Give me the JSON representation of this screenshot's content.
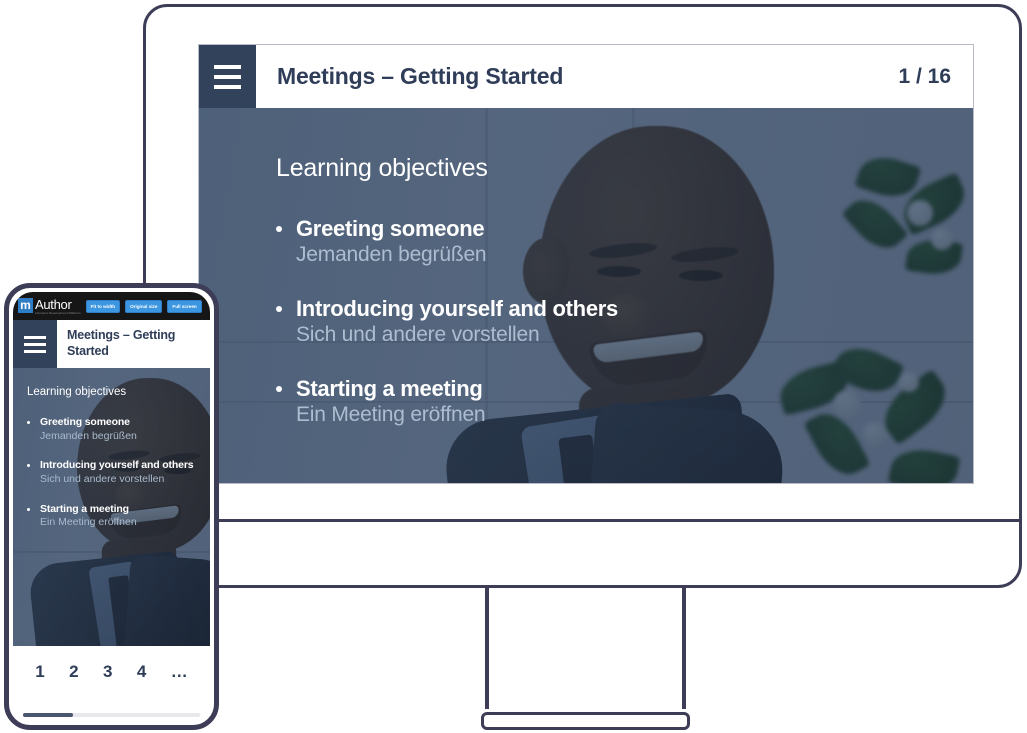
{
  "desktop": {
    "menu_icon": "hamburger-menu-icon",
    "title": "Meetings – Getting Started",
    "page_counter": "1 / 16",
    "slide": {
      "heading": "Learning objectives",
      "bullets": [
        {
          "en": "Greeting someone",
          "de": "Jemanden begrüßen"
        },
        {
          "en": "Introducing yourself and others",
          "de": "Sich und andere vorstellen"
        },
        {
          "en": "Starting a meeting",
          "de": "Ein Meeting eröffnen"
        }
      ]
    }
  },
  "phone": {
    "browser_bar": {
      "logo_mark": "m",
      "logo_word": "Author",
      "logo_tagline": "eContent Development Platform",
      "buttons": [
        "Fit to width",
        "Original size",
        "Full screen"
      ]
    },
    "menu_icon": "hamburger-menu-icon",
    "title": "Meetings – Getting Started",
    "slide": {
      "heading": "Learning objectives",
      "bullets": [
        {
          "en": "Greeting someone",
          "de": "Jemanden begrüßen"
        },
        {
          "en": "Introducing yourself and others",
          "de": "Sich und andere vorstellen"
        },
        {
          "en": "Starting a meeting",
          "de": "Ein Meeting eröffnen"
        }
      ]
    },
    "pagination": [
      "1",
      "2",
      "3",
      "4",
      "…"
    ]
  },
  "colors": {
    "frame": "#3d3d57",
    "header_dark": "#33425b",
    "text_navy": "#2f3d58",
    "slide_overlay": "#2e4463",
    "subtitle": "#adbdd0",
    "browser_button": "#3d96e0",
    "logo_blue": "#2f7dc4"
  }
}
